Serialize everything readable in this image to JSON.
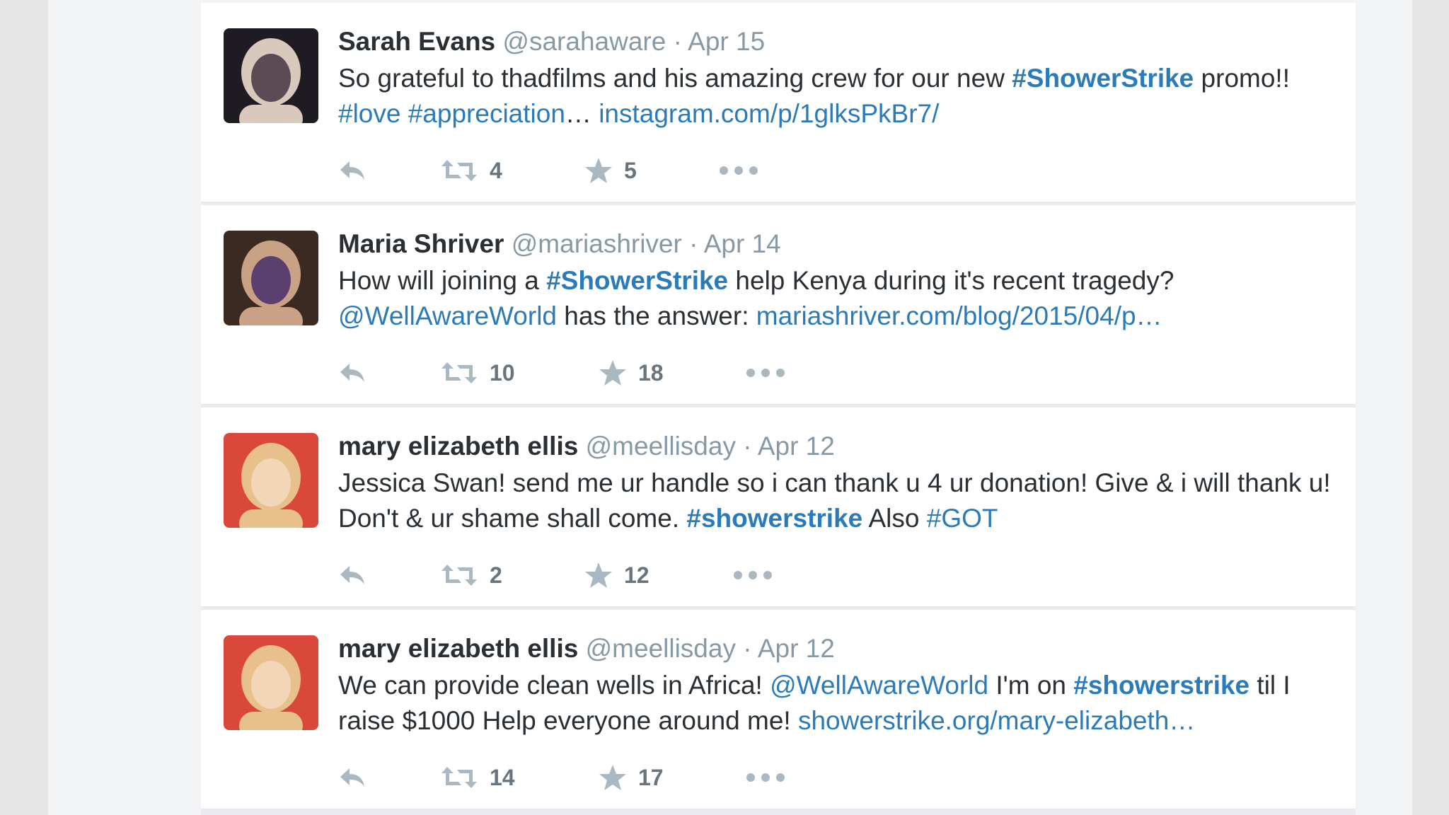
{
  "tweets": [
    {
      "fullname": "Sarah Evans",
      "handle": "@sarahaware",
      "separator": "·",
      "date": "Apr 15",
      "segments": [
        {
          "t": "So grateful to thadfilms and his amazing crew for our new "
        },
        {
          "t": "#ShowerStrike",
          "k": "tag"
        },
        {
          "t": " promo!! "
        },
        {
          "t": "#love",
          "k": "link"
        },
        {
          "t": " "
        },
        {
          "t": "#appreciation",
          "k": "link"
        },
        {
          "t": "… "
        },
        {
          "t": "instagram.com/p/1glksPkBr7/",
          "k": "link"
        }
      ],
      "retweets": "4",
      "favorites": "5",
      "avatar_colors": [
        "#1f1b22",
        "#d9c9bc",
        "#5a4b55"
      ]
    },
    {
      "fullname": "Maria Shriver",
      "handle": "@mariashriver",
      "separator": "·",
      "date": "Apr 14",
      "segments": [
        {
          "t": "How will joining a "
        },
        {
          "t": "#ShowerStrike",
          "k": "tag"
        },
        {
          "t": " help Kenya during it's recent tragedy? "
        },
        {
          "t": "@WellAwareWorld",
          "k": "link"
        },
        {
          "t": " has the answer: "
        },
        {
          "t": "mariashriver.com/blog/2015/04/p…",
          "k": "link"
        }
      ],
      "retweets": "10",
      "favorites": "18",
      "avatar_colors": [
        "#3b2a22",
        "#c9a286",
        "#5b3f6e"
      ]
    },
    {
      "fullname": "mary elizabeth ellis",
      "handle": "@meellisday",
      "separator": "·",
      "date": "Apr 12",
      "segments": [
        {
          "t": "Jessica Swan! send me ur handle so i can thank u 4 ur donation! Give & i will thank u! Don't & ur shame shall come. "
        },
        {
          "t": "#showerstrike",
          "k": "tag"
        },
        {
          "t": " Also "
        },
        {
          "t": "#GOT",
          "k": "link"
        }
      ],
      "retweets": "2",
      "favorites": "12",
      "avatar_colors": [
        "#d9483b",
        "#e8c08c",
        "#f1d7b8"
      ]
    },
    {
      "fullname": "mary elizabeth ellis",
      "handle": "@meellisday",
      "separator": "·",
      "date": "Apr 12",
      "segments": [
        {
          "t": "We can provide clean wells in Africa! "
        },
        {
          "t": "@WellAwareWorld",
          "k": "link"
        },
        {
          "t": " I'm on "
        },
        {
          "t": "#showerstrike",
          "k": "tag"
        },
        {
          "t": " til I raise $1000 Help everyone around me! "
        },
        {
          "t": "showerstrike.org/mary-elizabeth…",
          "k": "link"
        }
      ],
      "retweets": "14",
      "favorites": "17",
      "avatar_colors": [
        "#d9483b",
        "#e8c08c",
        "#f1d7b8"
      ]
    }
  ],
  "icons": {
    "reply": "reply-icon",
    "retweet": "retweet-icon",
    "favorite": "star-icon",
    "more": "more-icon"
  },
  "colors": {
    "link": "#2b7bb9",
    "name": "#292f33",
    "muted": "#8899a6",
    "background": "#e9ebee"
  }
}
